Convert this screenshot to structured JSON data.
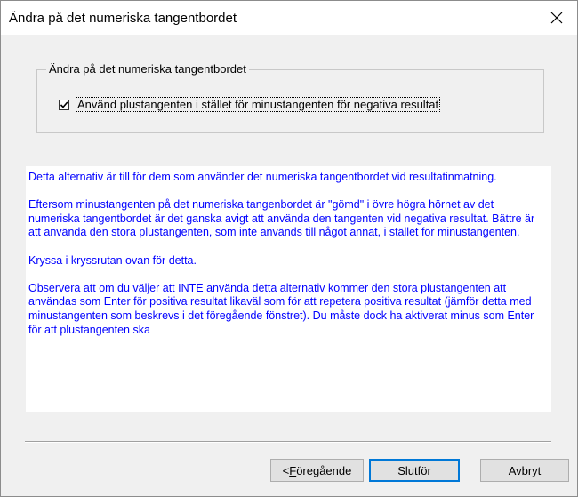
{
  "window": {
    "title": "Ändra på det numeriska tangentbordet"
  },
  "group": {
    "legend": "Ändra på det numeriska tangentbordet",
    "checkbox": {
      "label": "Använd plustangenten i stället för minustangenten för negativa resultat",
      "checked": true
    }
  },
  "info": {
    "paragraphs": [
      "Detta alternativ är till för dem som använder det numeriska tangentbordet vid resultatinmatning.",
      "Eftersom minustangenten på det numeriska tangenbordet är \"gömd\" i övre högra hörnet av det numeriska tangentbordet är det ganska avigt att använda den tangenten vid negativa resultat. Bättre är att använda den stora plustangenten, som inte används till något annat, i stället för minustangenten.",
      "Kryssa i kryssrutan ovan för detta.",
      "Observera att om du väljer att INTE använda detta alternativ kommer den stora plustangenten att användas som Enter för positiva resultat likaväl som för att repetera positiva resultat (jämför detta med minustangenten som beskrevs i det föregående fönstret). Du måste dock ha aktiverat minus som Enter för att plustangenten ska"
    ]
  },
  "buttons": {
    "back_prefix": "< ",
    "back_mnemonic": "F",
    "back_rest": "öregående",
    "finish": "Slutför",
    "cancel": "Avbryt"
  },
  "colors": {
    "info_text": "#0000ff",
    "default_button_border": "#0078d7"
  },
  "icons": {
    "close": "close-icon",
    "checkmark": "checkmark-icon"
  }
}
